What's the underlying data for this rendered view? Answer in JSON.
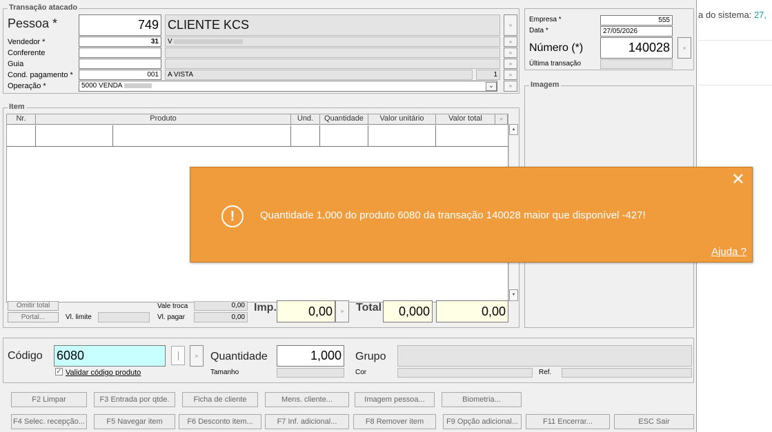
{
  "background": {
    "text_prefix": "a do sistema:",
    "text_value": "27,"
  },
  "transacao": {
    "title": "Transação atacado",
    "pessoa": {
      "label": "Pessoa *",
      "code": "749",
      "name": "CLIENTE  KCS"
    },
    "vendedor": {
      "label": "Vendedor *",
      "code": "31",
      "name": "V"
    },
    "conferente": {
      "label": "Conferente"
    },
    "guia": {
      "label": "Guia"
    },
    "cond_pagamento": {
      "label": "Cond. pagamento *",
      "code": "001",
      "name": "A VISTA",
      "parcelas": "1"
    },
    "operacao": {
      "label": "Operação *",
      "value": "5000 VENDA"
    }
  },
  "empresa": {
    "empresa_label": "Empresa *",
    "empresa_value": "555",
    "data_label": "Data *",
    "data_value": "27/05/2026",
    "numero_label": "Número (*)",
    "numero_value": "140028",
    "ultima_label": "Última transação"
  },
  "imagem": {
    "title": "Imagem"
  },
  "item": {
    "title": "Item",
    "columns": [
      "Nr.",
      "Produto",
      "Und.",
      "Quantidade",
      "Valor unitário",
      "Valor total"
    ]
  },
  "totais": {
    "omitir_total": "Omitir total",
    "portal": "Portal...",
    "vl_limite": "Vl. limite",
    "vale_troca_label": "Vale troca",
    "vale_troca_value": "0,00",
    "vl_pagar_label": "Vl. pagar",
    "vl_pagar_value": "0,00",
    "imp_label": "Imp.",
    "imp_value": "0,00",
    "total_label": "Total",
    "total_qtd": "0,000",
    "total_value": "0,00"
  },
  "entrada": {
    "codigo_label": "Código",
    "codigo_value": "6080",
    "validar_label": "Validar código produto",
    "quantidade_label": "Quantidade",
    "quantidade_value": "1,000",
    "tamanho_label": "Tamanho",
    "grupo_label": "Grupo",
    "cor_label": "Cor",
    "ref_label": "Ref."
  },
  "buttons_row1": [
    "F2 Limpar",
    "F3 Entrada por qtde.",
    "Ficha de cliente",
    "Mens. cliente...",
    "Imagem pessoa...",
    "Biometria..."
  ],
  "buttons_row2": [
    "F4 Selec. recepção...",
    "F5 Navegar item",
    "F6 Desconto item...",
    "F7 Inf. adicional...",
    "F8 Remover item",
    "F9 Opção adicional...",
    "F11 Encerrar...",
    "ESC Sair"
  ],
  "toast": {
    "message": "Quantidade 1,000 do produto 6080 da transação 140028 maior que disponível -427!",
    "help": "Ajuda ?",
    "close": "✕",
    "alert_glyph": "!",
    "color": "#f09c3c"
  },
  "icons": {
    "lookup": "»",
    "dropdown": "⌄",
    "scroll_up": "▲",
    "scroll_down": "▼",
    "check": "✓"
  }
}
